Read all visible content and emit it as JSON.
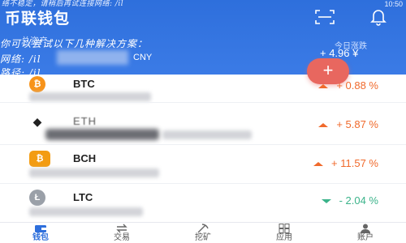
{
  "status_bar": {
    "overlay_text": "络不稳定，请稍后再试连接网络: /il",
    "time": "10:50"
  },
  "header": {
    "app_title": "币联钱包",
    "overlay_line1": "你可以尝试以下几种解决方案：",
    "overlay_line2": "网络: /il",
    "overlay_line3": "路径: /il",
    "total_assets_label": "总资产",
    "currency": "CNY",
    "today_gain_label": "今日涨跌",
    "today_gain_value": "+ 4.96 ¥"
  },
  "fab": {
    "label": "+"
  },
  "coins": [
    {
      "symbol": "BTC",
      "logo_color": "#f7931a",
      "logo_glyph": "₿",
      "change": "+ 0.88 %",
      "direction": "up"
    },
    {
      "symbol": "ETH",
      "logo_color": "#ffffff",
      "logo_glyph": "◆",
      "change": "+ 5.87 %",
      "direction": "up"
    },
    {
      "symbol": "BCH",
      "logo_color": "#f39c12",
      "logo_glyph": "₿",
      "change": "+ 11.57 %",
      "direction": "up"
    },
    {
      "symbol": "LTC",
      "logo_color": "#9aa0a8",
      "logo_glyph": "Ł",
      "change": "- 2.04 %",
      "direction": "down"
    }
  ],
  "bottom_nav": [
    {
      "label": "钱包",
      "icon": "wallet-icon",
      "active": true
    },
    {
      "label": "交易",
      "icon": "exchange-icon",
      "active": false
    },
    {
      "label": "挖矿",
      "icon": "mining-icon",
      "active": false
    },
    {
      "label": "应用",
      "icon": "apps-icon",
      "active": false
    },
    {
      "label": "账户",
      "icon": "account-icon",
      "active": false
    }
  ],
  "colors": {
    "header_blue": "#2e6fdc",
    "up": "#f06a2c",
    "down": "#3bb38a",
    "fab": "#e8675f"
  }
}
